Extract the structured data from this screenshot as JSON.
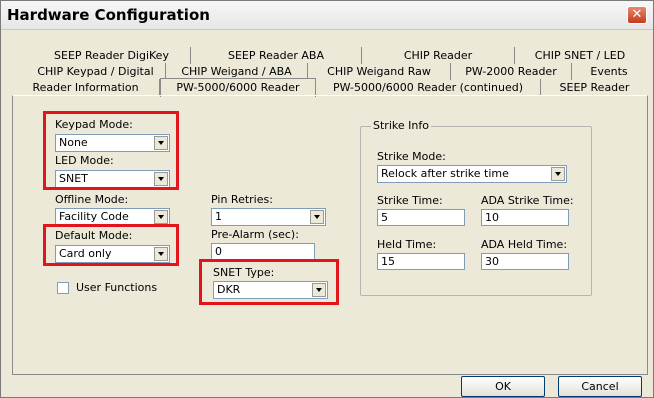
{
  "window": {
    "title": "Hardware Configuration",
    "close_glyph": "✕"
  },
  "tabs": {
    "row1": [
      "SEEP Reader DigiKey",
      "SEEP Reader ABA",
      "CHIP Reader",
      "CHIP SNET / LED"
    ],
    "row2": [
      "CHIP Keypad / Digital",
      "CHIP Weigand / ABA",
      "CHIP Weigand Raw",
      "PW-2000 Reader",
      "Events"
    ],
    "row3": [
      "Reader Information",
      "PW-5000/6000 Reader",
      "PW-5000/6000 Reader (continued)",
      "SEEP Reader"
    ],
    "active": "PW-5000/6000 Reader"
  },
  "form": {
    "keypad_mode": {
      "label": "Keypad Mode:",
      "value": "None"
    },
    "led_mode": {
      "label": "LED Mode:",
      "value": "SNET"
    },
    "offline_mode": {
      "label": "Offline Mode:",
      "value": "Facility Code"
    },
    "default_mode": {
      "label": "Default Mode:",
      "value": "Card only"
    },
    "user_functions": {
      "label": "User Functions",
      "checked": false
    },
    "pin_retries": {
      "label": "Pin Retries:",
      "value": "1"
    },
    "pre_alarm": {
      "label": "Pre-Alarm (sec):",
      "value": "0"
    },
    "snet_type": {
      "label": "SNET Type:",
      "value": "DKR"
    }
  },
  "strike_info": {
    "legend": "Strike Info",
    "strike_mode": {
      "label": "Strike Mode:",
      "value": "Relock after strike time"
    },
    "strike_time": {
      "label": "Strike Time:",
      "value": "5"
    },
    "ada_strike_time": {
      "label": "ADA Strike Time:",
      "value": "10"
    },
    "held_time": {
      "label": "Held Time:",
      "value": "15"
    },
    "ada_held_time": {
      "label": "ADA Held Time:",
      "value": "30"
    }
  },
  "buttons": {
    "ok": "OK",
    "cancel": "Cancel"
  },
  "colors": {
    "highlight": "#e3141c",
    "dialog_bg": "#ece9d8"
  }
}
